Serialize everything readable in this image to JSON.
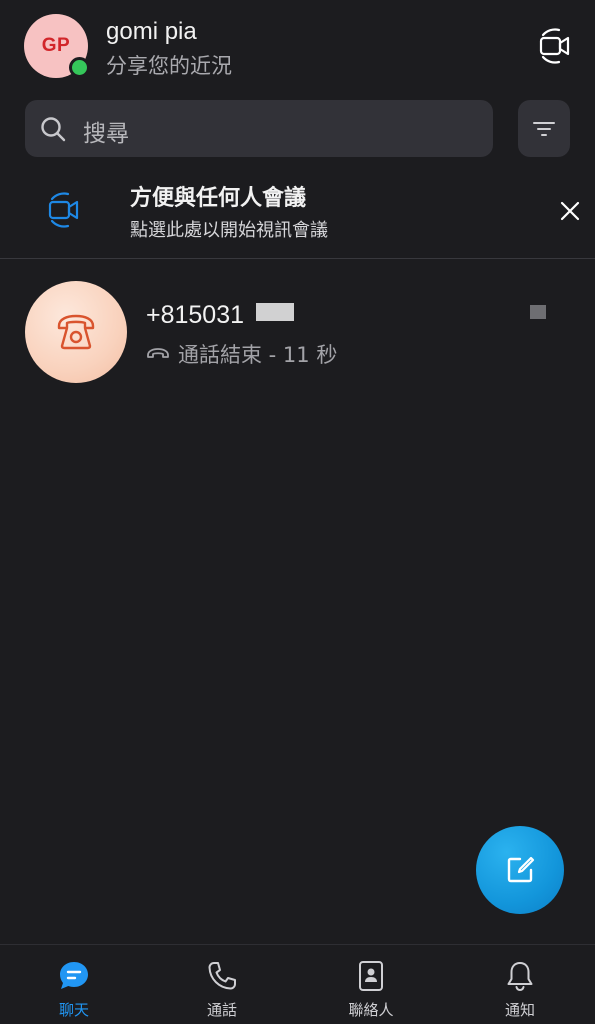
{
  "header": {
    "avatar_initials": "GP",
    "user_name": "gomi pia",
    "status": "分享您的近況",
    "presence": "online",
    "meet_icon": "meet-now-icon"
  },
  "search": {
    "placeholder": "搜尋",
    "icon": "search-icon",
    "filter_icon": "filter-icon"
  },
  "banner": {
    "title": "方便與任何人會議",
    "subtitle": "點選此處以開始視訊會議",
    "icon": "meet-now-icon",
    "close_icon": "close-icon"
  },
  "chats": [
    {
      "title": "+815031",
      "title_redacted": true,
      "subtitle": "通話結束 - 11 秒",
      "avatar_icon": "telephone-icon",
      "status_icon": "call-end-icon"
    }
  ],
  "fab": {
    "icon": "compose-icon"
  },
  "bottom_nav": [
    {
      "label": "聊天",
      "icon": "chat-icon",
      "active": true
    },
    {
      "label": "通話",
      "icon": "phone-icon",
      "active": false
    },
    {
      "label": "聯絡人",
      "icon": "contacts-icon",
      "active": false
    },
    {
      "label": "通知",
      "icon": "bell-icon",
      "active": false
    }
  ],
  "colors": {
    "background": "#1c1c1f",
    "accent": "#2196f3",
    "presence": "#35c65a",
    "avatar_text": "#d2262a",
    "phone_icon": "#d9542e"
  }
}
